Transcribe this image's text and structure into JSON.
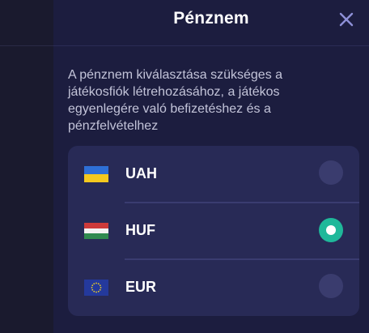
{
  "modal": {
    "title": "Pénznem",
    "close_icon": "close-icon",
    "description": "A pénznem kiválasztása szükséges a játékosfiók létrehozásához, a játékos egyenlegére való befizetéshez és a pénzfelvételhez"
  },
  "currencies": [
    {
      "code": "UAH",
      "flag": "ukraine-flag-icon",
      "selected": false
    },
    {
      "code": "HUF",
      "flag": "hungary-flag-icon",
      "selected": true
    },
    {
      "code": "EUR",
      "flag": "eu-flag-icon",
      "selected": false
    }
  ],
  "colors": {
    "panel": "#1c1d3f",
    "list_bg": "#282a56",
    "accent_selected": "#1fb89a",
    "radio_unselected": "#3a3c6e",
    "close_icon": "#8e90d8"
  }
}
